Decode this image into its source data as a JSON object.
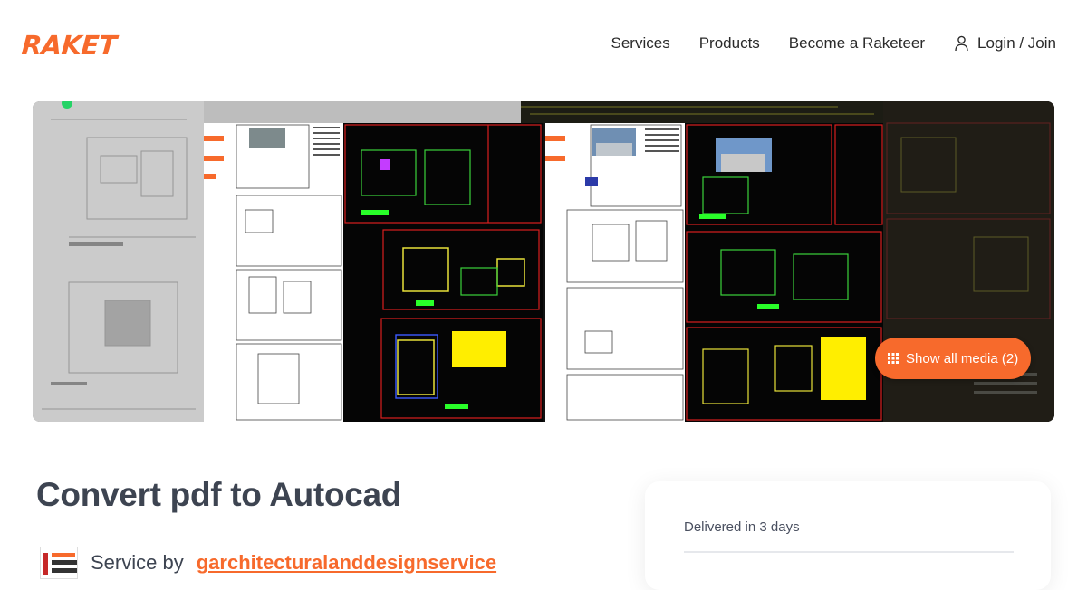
{
  "brand": {
    "logo_text": "RAKET",
    "accent": "#f76a2c"
  },
  "nav": {
    "services": "Services",
    "products": "Products",
    "become": "Become a Raketeer",
    "login": "Login / Join",
    "login_icon": "user-icon"
  },
  "gallery": {
    "show_all_label": "Show all media (2)",
    "show_all_icon": "grid-icon"
  },
  "service": {
    "title": "Convert pdf to Autocad",
    "by_label": "Service by",
    "seller_name": "garchitecturalanddesignservice"
  },
  "card": {
    "delivery": "Delivered in 3 days"
  }
}
